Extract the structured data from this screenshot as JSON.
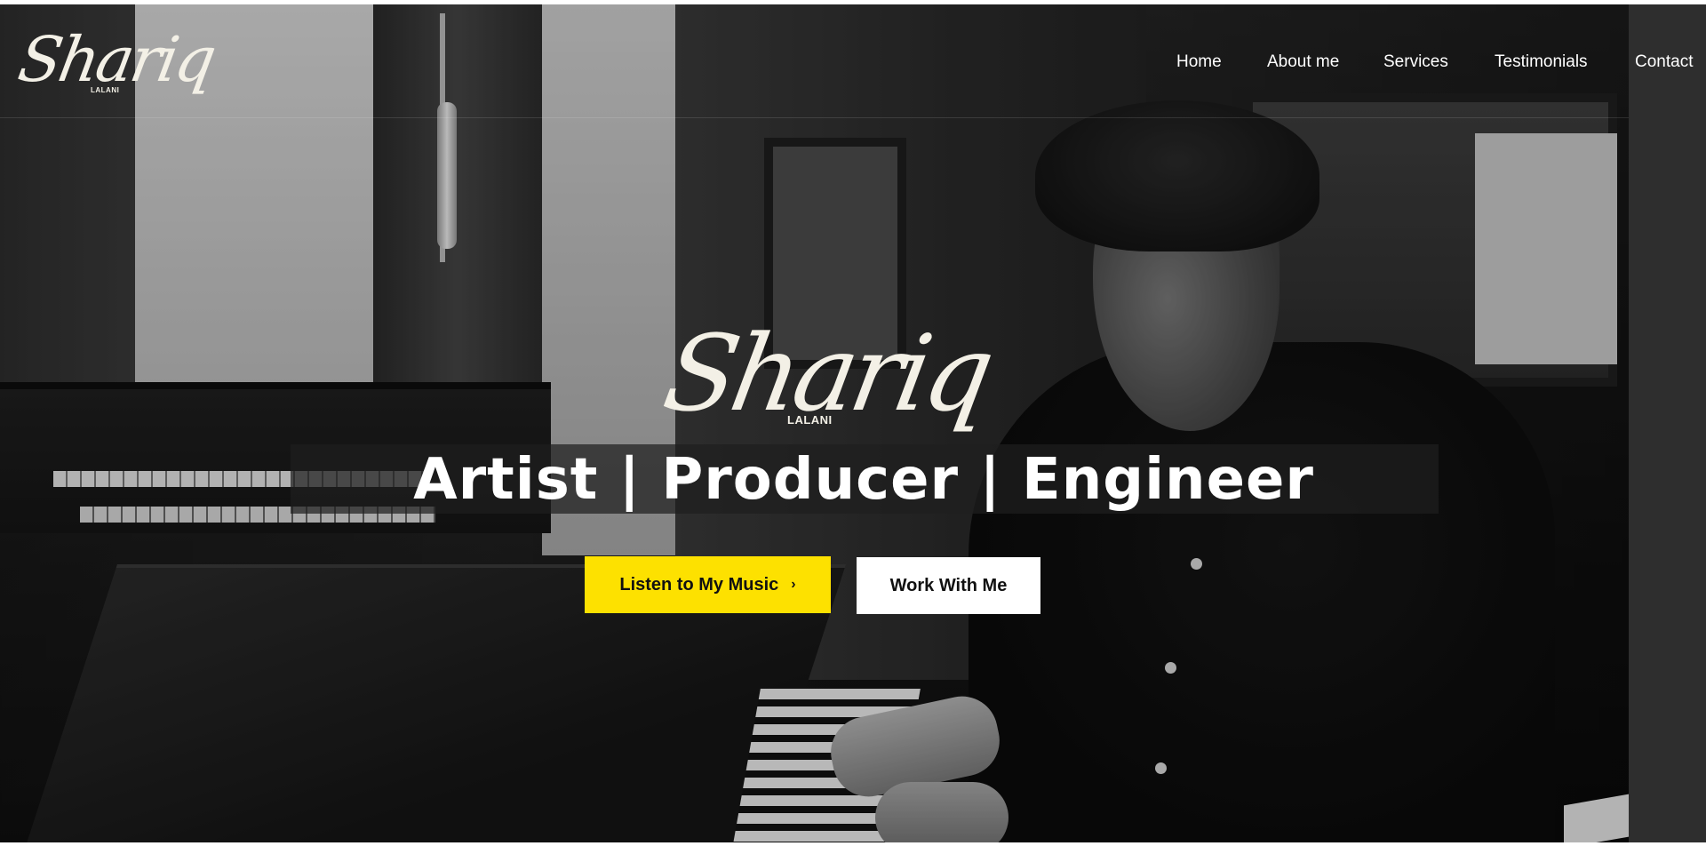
{
  "header": {
    "logo": {
      "script": "Shariq",
      "sub": "LALANI"
    },
    "nav": [
      {
        "label": "Home"
      },
      {
        "label": "About me"
      },
      {
        "label": "Services"
      },
      {
        "label": "Testimonials"
      },
      {
        "label": "Contact"
      }
    ]
  },
  "hero": {
    "logo": {
      "script": "Shariq",
      "sub": "LALANI"
    },
    "tagline": "Artist | Producer | Engineer",
    "buttons": {
      "listen_label": "Listen to My Music",
      "listen_chevron": "›",
      "work_label": "Work With Me"
    }
  },
  "colors": {
    "accent_yellow": "#fde100",
    "text_light": "#f3f0e6",
    "white": "#ffffff"
  }
}
